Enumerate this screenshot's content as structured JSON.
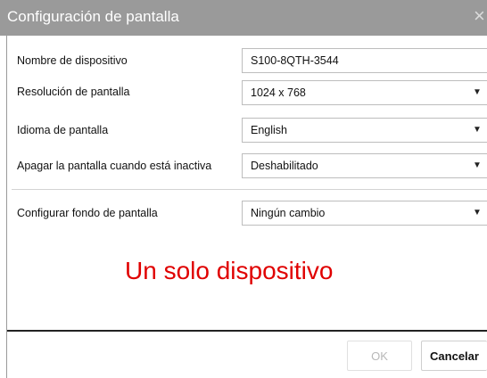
{
  "dialog": {
    "title": "Configuración de pantalla",
    "close_glyph": "×"
  },
  "rows": [
    {
      "label": "Nombre de dispositivo",
      "value": "S100-8QTH-3544",
      "has_dropdown": false
    },
    {
      "label": "Resolución de pantalla",
      "value": "1024 x 768",
      "has_dropdown": true
    },
    {
      "label": "Idioma de pantalla",
      "value": "English",
      "has_dropdown": true
    },
    {
      "label": "Apagar la pantalla cuando está inactiva",
      "value": "Deshabilitado",
      "has_dropdown": true
    },
    {
      "label": "Configurar fondo de pantalla",
      "value": "Ningún cambio",
      "has_dropdown": true
    }
  ],
  "annotation": {
    "text": "Un solo dispositivo",
    "color": "#e00000"
  },
  "footer": {
    "ok_label": "OK",
    "cancel_label": "Cancelar"
  },
  "colors": {
    "titlebar": "#9a9a9a"
  },
  "icons": {
    "dropdown": "▼"
  }
}
